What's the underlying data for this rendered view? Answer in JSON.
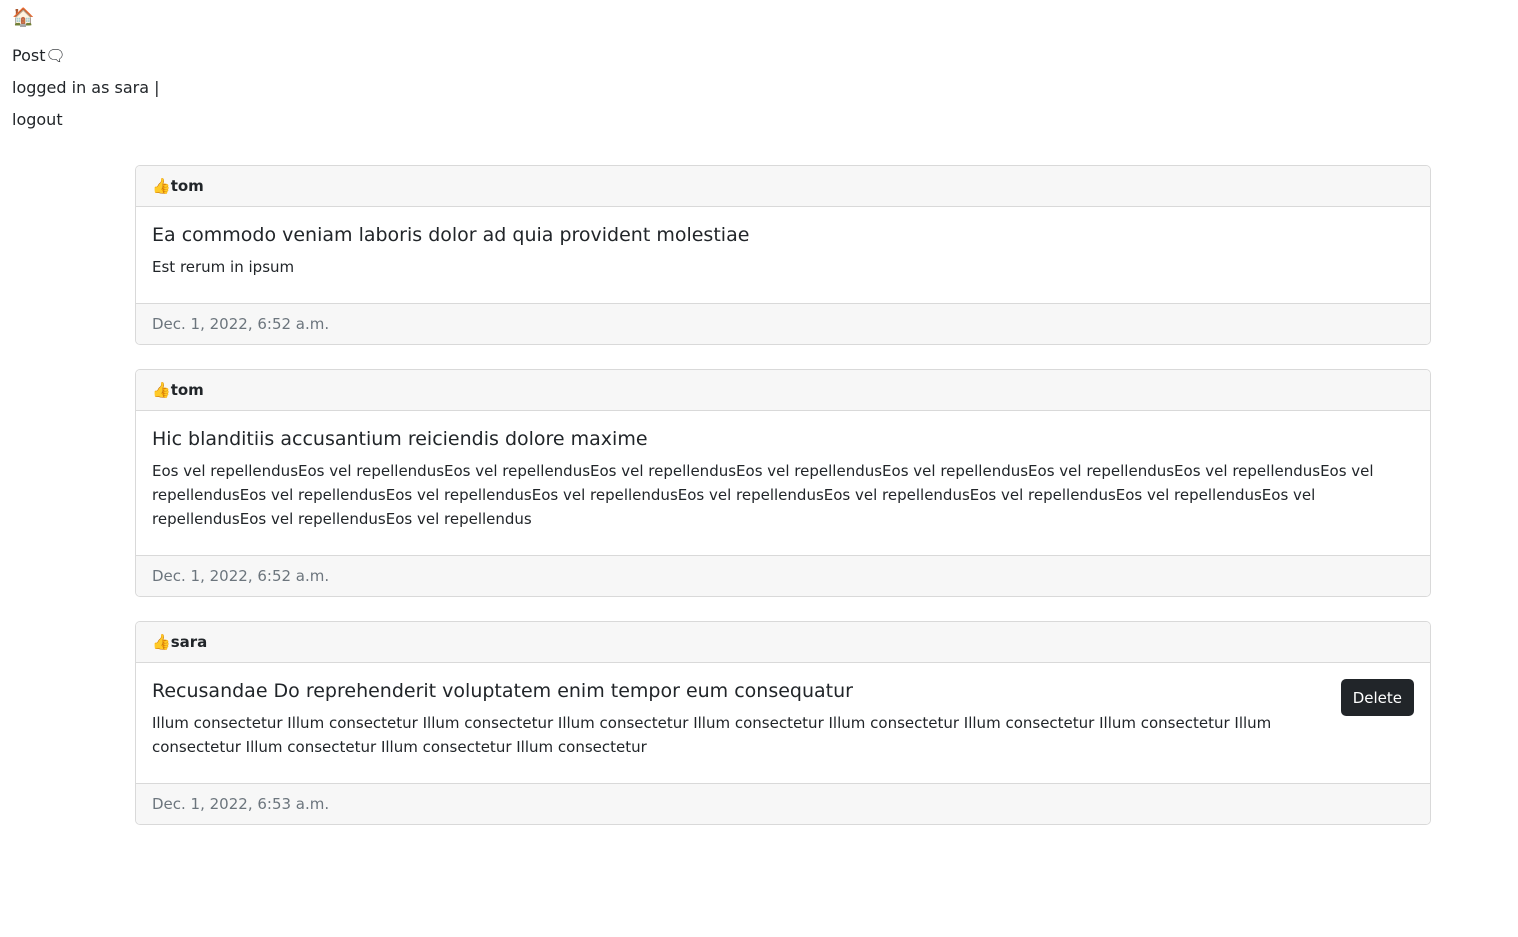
{
  "nav": {
    "home_icon": "🏠",
    "post_label": "Post🗨",
    "status_text": "logged in as sara |",
    "logout_label": "logout"
  },
  "posts": [
    {
      "author_icon": "👍",
      "author": "tom",
      "title": "Ea commodo veniam laboris dolor ad quia provident molestiae",
      "body": "Est rerum in ipsum",
      "timestamp": "Dec. 1, 2022, 6:52 a.m."
    },
    {
      "author_icon": "👍",
      "author": "tom",
      "title": "Hic blanditiis accusantium reiciendis dolore maxime",
      "body": "Eos vel repellendusEos vel repellendusEos vel repellendusEos vel repellendusEos vel repellendusEos vel repellendusEos vel repellendusEos vel repellendusEos vel repellendusEos vel repellendusEos vel repellendusEos vel repellendusEos vel repellendusEos vel repellendusEos vel repellendusEos vel repellendusEos vel repellendusEos vel repellendusEos vel repellendus",
      "timestamp": "Dec. 1, 2022, 6:52 a.m."
    },
    {
      "author_icon": "👍",
      "author": "sara",
      "title": "Recusandae Do reprehenderit voluptatem enim tempor eum consequatur",
      "body": "Illum consectetur Illum consectetur Illum consectetur Illum consectetur Illum consectetur Illum consectetur Illum consectetur Illum consectetur Illum consectetur Illum consectetur Illum consectetur Illum consectetur",
      "timestamp": "Dec. 1, 2022, 6:53 a.m.",
      "delete_label": "Delete"
    }
  ]
}
